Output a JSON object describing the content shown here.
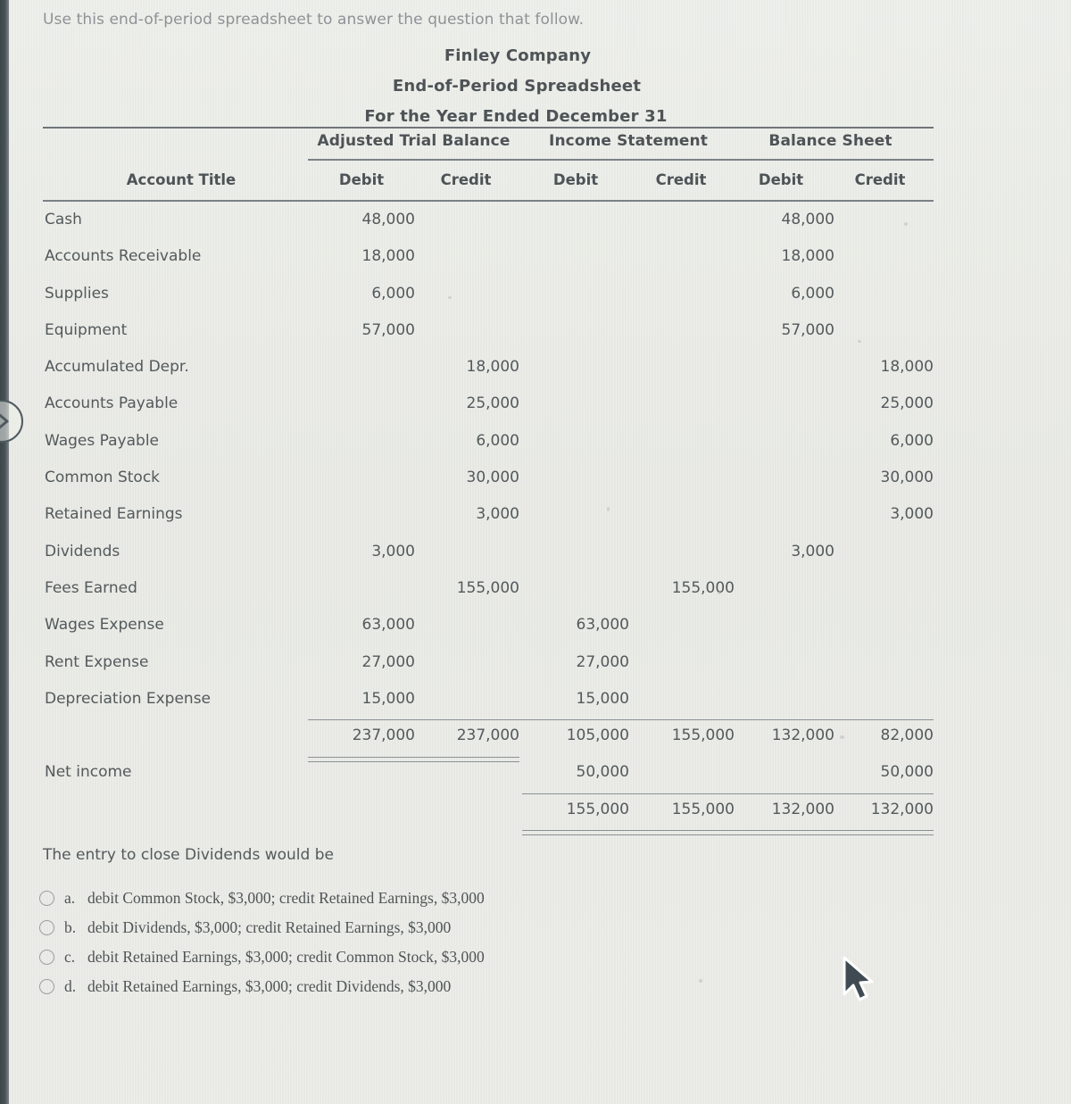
{
  "intro": "Use this end-of-period spreadsheet to answer the question that follow.",
  "report": {
    "company": "Finley Company",
    "statement": "End-of-Period Spreadsheet",
    "period": "For the Year Ended December 31"
  },
  "table": {
    "group_headers": [
      "Adjusted Trial Balance",
      "Income Statement",
      "Balance Sheet"
    ],
    "column_headers": [
      "Account Title",
      "Debit",
      "Credit",
      "Debit",
      "Credit",
      "Debit",
      "Credit"
    ],
    "rows": [
      {
        "account": "Cash",
        "atb_debit": "48,000",
        "atb_credit": "",
        "is_debit": "",
        "is_credit": "",
        "bs_debit": "48,000",
        "bs_credit": ""
      },
      {
        "account": "Accounts Receivable",
        "atb_debit": "18,000",
        "atb_credit": "",
        "is_debit": "",
        "is_credit": "",
        "bs_debit": "18,000",
        "bs_credit": ""
      },
      {
        "account": "Supplies",
        "atb_debit": "6,000",
        "atb_credit": "",
        "is_debit": "",
        "is_credit": "",
        "bs_debit": "6,000",
        "bs_credit": ""
      },
      {
        "account": "Equipment",
        "atb_debit": "57,000",
        "atb_credit": "",
        "is_debit": "",
        "is_credit": "",
        "bs_debit": "57,000",
        "bs_credit": ""
      },
      {
        "account": "Accumulated Depr.",
        "atb_debit": "",
        "atb_credit": "18,000",
        "is_debit": "",
        "is_credit": "",
        "bs_debit": "",
        "bs_credit": "18,000"
      },
      {
        "account": "Accounts Payable",
        "atb_debit": "",
        "atb_credit": "25,000",
        "is_debit": "",
        "is_credit": "",
        "bs_debit": "",
        "bs_credit": "25,000"
      },
      {
        "account": "Wages Payable",
        "atb_debit": "",
        "atb_credit": "6,000",
        "is_debit": "",
        "is_credit": "",
        "bs_debit": "",
        "bs_credit": "6,000"
      },
      {
        "account": "Common Stock",
        "atb_debit": "",
        "atb_credit": "30,000",
        "is_debit": "",
        "is_credit": "",
        "bs_debit": "",
        "bs_credit": "30,000"
      },
      {
        "account": "Retained Earnings",
        "atb_debit": "",
        "atb_credit": "3,000",
        "is_debit": "",
        "is_credit": "",
        "bs_debit": "",
        "bs_credit": "3,000"
      },
      {
        "account": "Dividends",
        "atb_debit": "3,000",
        "atb_credit": "",
        "is_debit": "",
        "is_credit": "",
        "bs_debit": "3,000",
        "bs_credit": ""
      },
      {
        "account": "Fees Earned",
        "atb_debit": "",
        "atb_credit": "155,000",
        "is_debit": "",
        "is_credit": "155,000",
        "bs_debit": "",
        "bs_credit": ""
      },
      {
        "account": "Wages Expense",
        "atb_debit": "63,000",
        "atb_credit": "",
        "is_debit": "63,000",
        "is_credit": "",
        "bs_debit": "",
        "bs_credit": ""
      },
      {
        "account": "Rent Expense",
        "atb_debit": "27,000",
        "atb_credit": "",
        "is_debit": "27,000",
        "is_credit": "",
        "bs_debit": "",
        "bs_credit": ""
      },
      {
        "account": "Depreciation Expense",
        "atb_debit": "15,000",
        "atb_credit": "",
        "is_debit": "15,000",
        "is_credit": "",
        "bs_debit": "",
        "bs_credit": ""
      }
    ],
    "subtotal": {
      "account": "",
      "atb_debit": "237,000",
      "atb_credit": "237,000",
      "is_debit": "105,000",
      "is_credit": "155,000",
      "bs_debit": "132,000",
      "bs_credit": "82,000"
    },
    "net_income": {
      "account": "Net income",
      "atb_debit": "",
      "atb_credit": "",
      "is_debit": "50,000",
      "is_credit": "",
      "bs_debit": "",
      "bs_credit": "50,000"
    },
    "total": {
      "account": "",
      "atb_debit": "",
      "atb_credit": "",
      "is_debit": "155,000",
      "is_credit": "155,000",
      "bs_debit": "132,000",
      "bs_credit": "132,000"
    }
  },
  "question": {
    "prompt": "The entry to close Dividends would be",
    "options": [
      {
        "letter": "a.",
        "text": "debit Common Stock, $3,000; credit Retained Earnings, $3,000"
      },
      {
        "letter": "b.",
        "text": "debit Dividends, $3,000; credit Retained Earnings, $3,000"
      },
      {
        "letter": "c.",
        "text": "debit Retained Earnings, $3,000; credit Common Stock, $3,000"
      },
      {
        "letter": "d.",
        "text": "debit Retained Earnings, $3,000; credit Dividends, $3,000"
      }
    ],
    "selected": ""
  },
  "controls": {
    "next_icon": "chevron-right-icon",
    "cursor_icon": "mouse-pointer-icon"
  },
  "colors": {
    "page_background": "#e9eae5",
    "text": "#53595c",
    "heading": "#4d5356",
    "muted": "#8e9296",
    "rule": "#7b8186",
    "edge": "#465156"
  }
}
